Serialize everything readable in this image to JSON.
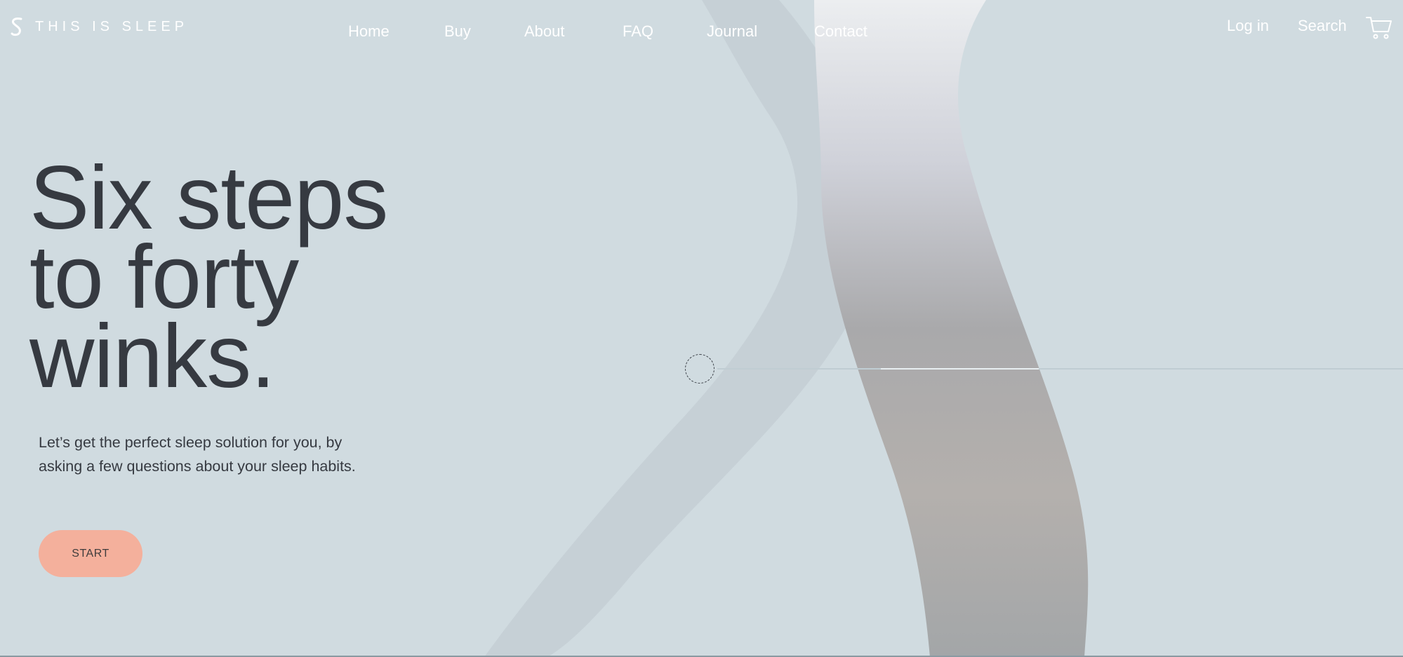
{
  "brand": {
    "name": "THIS IS SLEEP",
    "logo_icon": "s-logo-icon"
  },
  "nav": {
    "items": [
      {
        "label": "Home"
      },
      {
        "label": "Buy"
      },
      {
        "label": "About"
      },
      {
        "label": "FAQ"
      },
      {
        "label": "Journal"
      },
      {
        "label": "Contact"
      }
    ]
  },
  "header_actions": {
    "login": "Log in",
    "search": "Search",
    "cart_icon": "cart-icon"
  },
  "hero": {
    "headline": [
      "Six steps",
      "to forty",
      "winks."
    ],
    "subtext_lines": [
      "Let’s get the perfect sleep solution for you, by",
      "asking a few questions about your sleep habits."
    ],
    "cta": "START"
  },
  "colors": {
    "background": "#d0dbe0",
    "accent": "#f4b09c",
    "text": "#363a41",
    "nav_text": "#ffffff"
  }
}
